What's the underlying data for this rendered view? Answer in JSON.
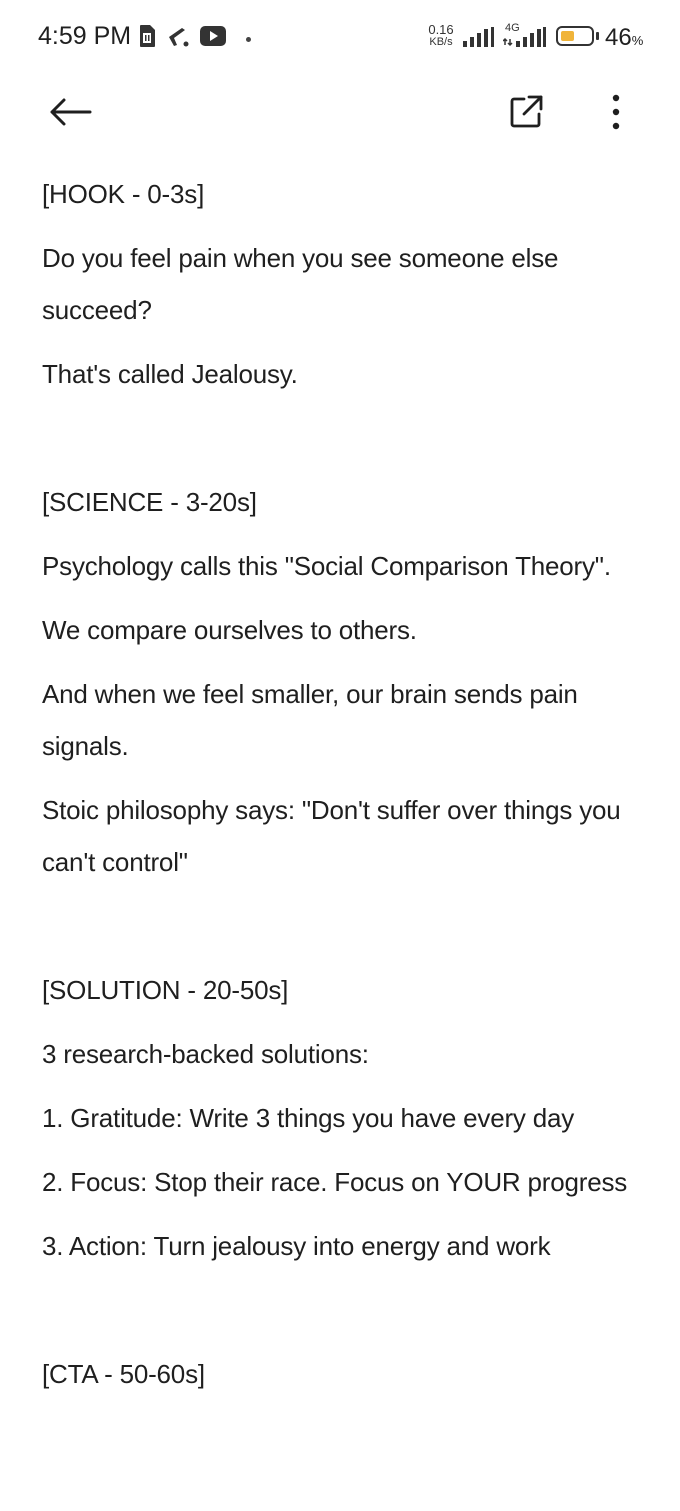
{
  "status_bar": {
    "time": "4:59 PM",
    "net_speed_value": "0.16",
    "net_speed_unit": "KB/s",
    "net_type": "4G",
    "battery_percent": "46",
    "battery_unit": "%",
    "battery_level": 0.46,
    "icons": [
      "sim-card-icon",
      "notification-icon",
      "youtube-icon",
      "signal-icon",
      "signal-4g-icon",
      "battery-icon"
    ]
  },
  "app_bar": {
    "icons": [
      "back-arrow-icon",
      "open-external-icon",
      "more-vert-icon"
    ]
  },
  "document": {
    "lines": [
      "[HOOK - 0-3s]",
      "Do you feel pain when you see someone else succeed?",
      "That's called Jealousy.",
      "",
      "[SCIENCE - 3-20s]",
      "Psychology calls this \"Social Comparison Theory\".",
      "We compare ourselves to others.",
      "And when we feel smaller, our brain sends pain signals.",
      "Stoic philosophy says: \"Don't suffer over things you can't control\"",
      "",
      "[SOLUTION - 20-50s]",
      "3 research-backed solutions:",
      "1. Gratitude: Write 3 things you have every day",
      "2. Focus: Stop their race. Focus on YOUR progress",
      "3. Action: Turn jealousy into energy and work",
      "",
      "[CTA - 50-60s]"
    ]
  }
}
